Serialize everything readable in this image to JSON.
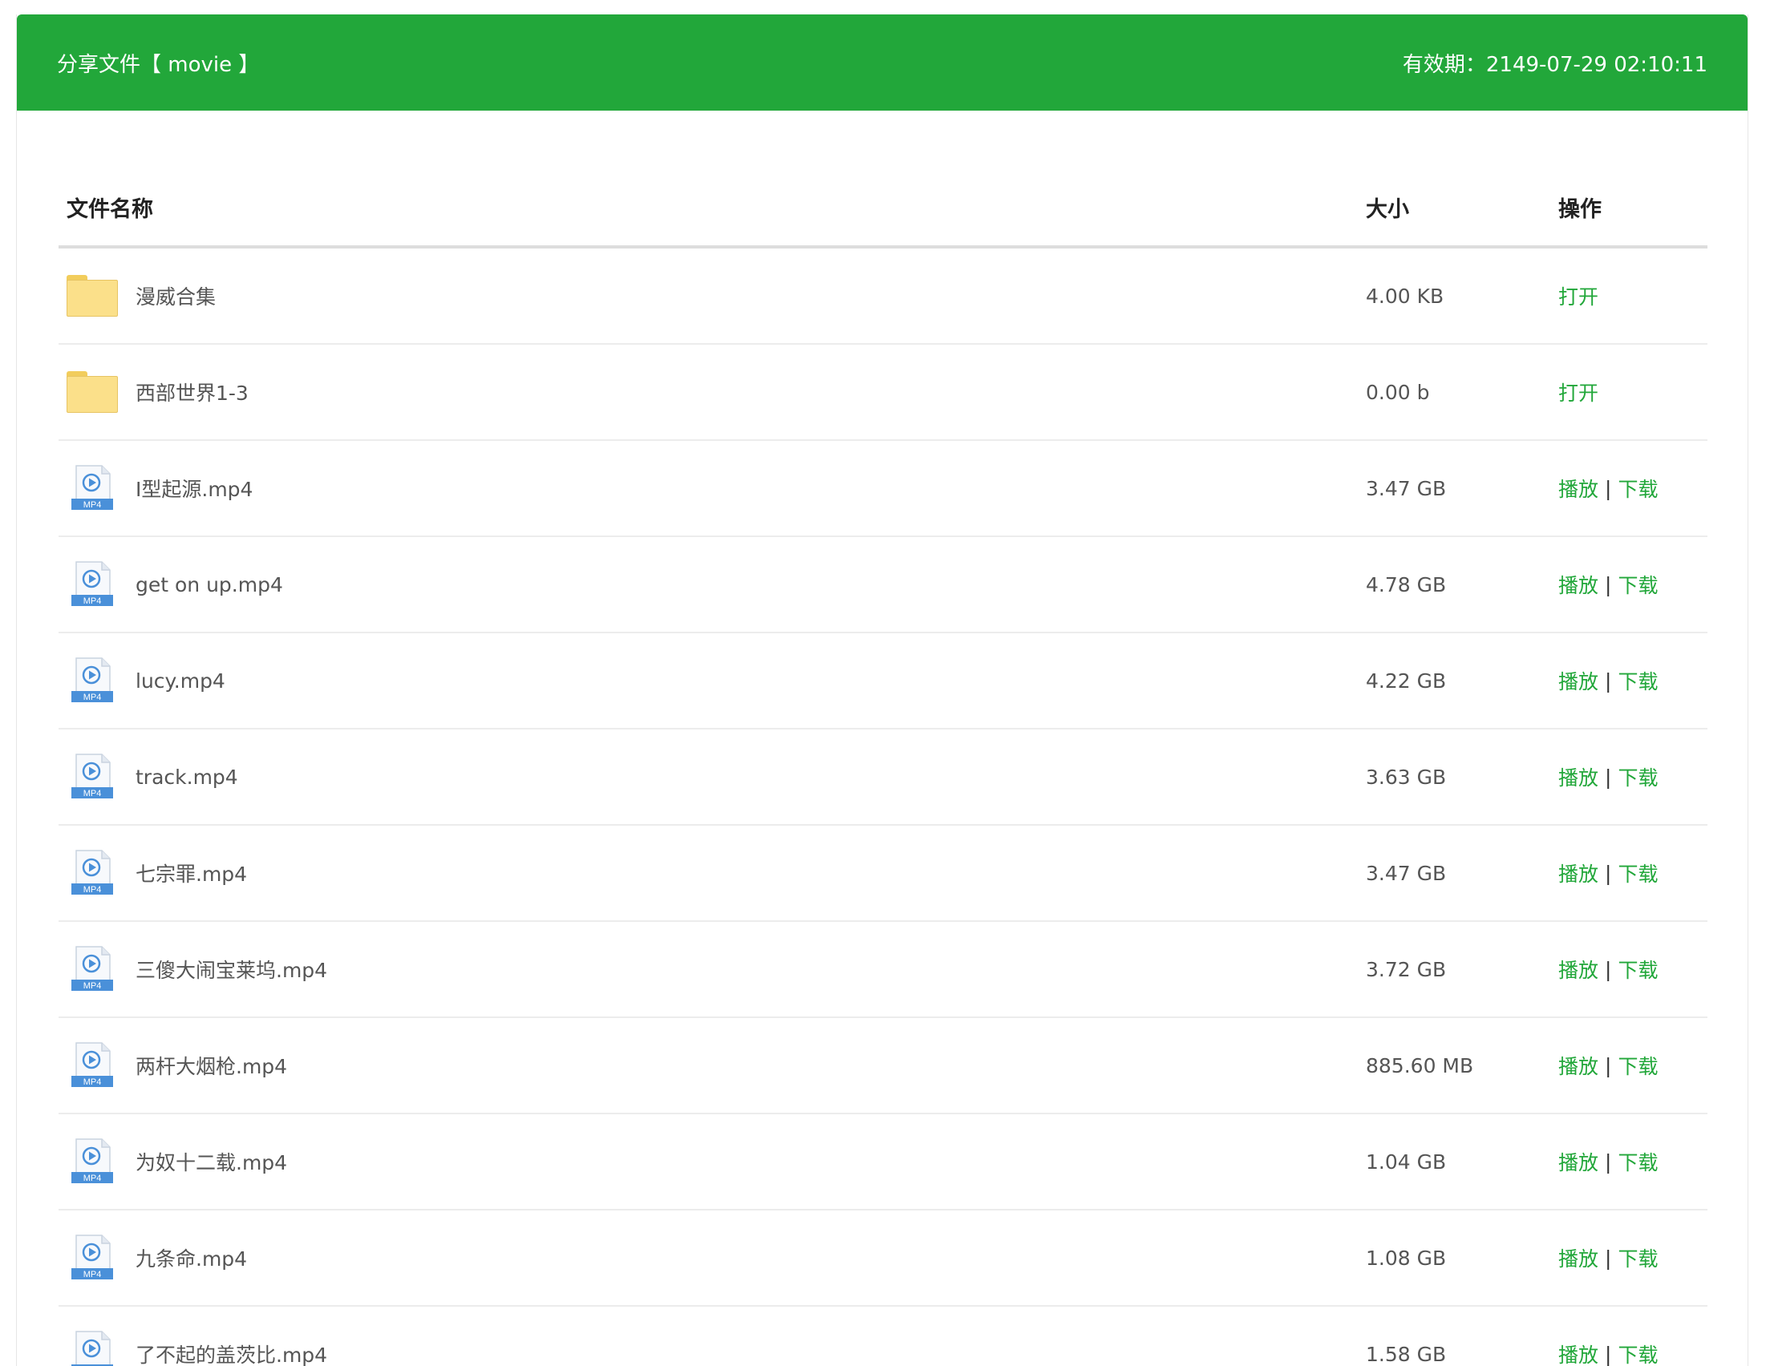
{
  "colors": {
    "accent": "#22a73a",
    "link": "#22a73a"
  },
  "header": {
    "title": "分享文件【 movie 】",
    "expiry": "有效期：2149-07-29 02:10:11"
  },
  "table": {
    "columns": {
      "name": "文件名称",
      "size": "大小",
      "ops": "操作"
    },
    "rows": [
      {
        "type": "folder",
        "name": "漫威合集",
        "size": "4.00 KB",
        "actions": [
          "打开"
        ]
      },
      {
        "type": "folder",
        "name": "西部世界1-3",
        "size": "0.00 b",
        "actions": [
          "打开"
        ]
      },
      {
        "type": "mp4",
        "name": "I型起源.mp4",
        "size": "3.47 GB",
        "actions": [
          "播放",
          "下载"
        ]
      },
      {
        "type": "mp4",
        "name": "get on up.mp4",
        "size": "4.78 GB",
        "actions": [
          "播放",
          "下载"
        ]
      },
      {
        "type": "mp4",
        "name": "lucy.mp4",
        "size": "4.22 GB",
        "actions": [
          "播放",
          "下载"
        ]
      },
      {
        "type": "mp4",
        "name": "track.mp4",
        "size": "3.63 GB",
        "actions": [
          "播放",
          "下载"
        ]
      },
      {
        "type": "mp4",
        "name": "七宗罪.mp4",
        "size": "3.47 GB",
        "actions": [
          "播放",
          "下载"
        ]
      },
      {
        "type": "mp4",
        "name": "三傻大闹宝莱坞.mp4",
        "size": "3.72 GB",
        "actions": [
          "播放",
          "下载"
        ]
      },
      {
        "type": "mp4",
        "name": "两杆大烟枪.mp4",
        "size": "885.60 MB",
        "actions": [
          "播放",
          "下载"
        ]
      },
      {
        "type": "mp4",
        "name": "为奴十二载.mp4",
        "size": "1.04 GB",
        "actions": [
          "播放",
          "下载"
        ]
      },
      {
        "type": "mp4",
        "name": "九条命.mp4",
        "size": "1.08 GB",
        "actions": [
          "播放",
          "下载"
        ]
      },
      {
        "type": "mp4",
        "name": "了不起的盖茨比.mp4",
        "size": "1.58 GB",
        "actions": [
          "播放",
          "下载"
        ]
      }
    ]
  },
  "icons": {
    "folder": "folder-icon",
    "mp4": "mp4-file-icon",
    "mp4_label": "MP4"
  }
}
